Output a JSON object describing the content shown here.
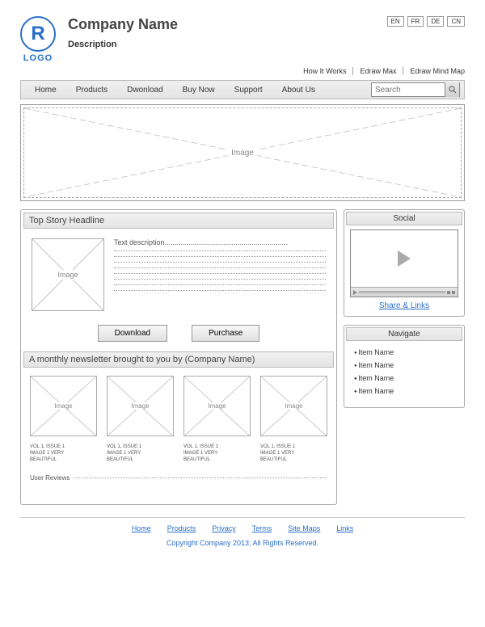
{
  "header": {
    "logo_letter": "R",
    "logo_text": "LOGO",
    "company_name": "Company Name",
    "description": "Description"
  },
  "languages": [
    "EN",
    "FR",
    "DE",
    "CN"
  ],
  "sub_links": [
    "How It Works",
    "Edraw Max",
    "Edraw Mind Map"
  ],
  "nav": [
    "Home",
    "Products",
    "Dwonload",
    "Buy Now",
    "Support",
    "About Us"
  ],
  "search_placeholder": "Search",
  "hero_label": "Image",
  "top_story": {
    "headline": "Top Story Headline",
    "image_label": "Image",
    "text_description": "Text description.............................................................",
    "download_btn": "Download",
    "purchase_btn": "Purchase"
  },
  "newsletter": {
    "headline": "A monthly newsletter brought to you by (Company Name)",
    "items": [
      {
        "img": "Image",
        "caption_l1": "VOL 1, ISSUE 1",
        "caption_l2": "IMAGE 1 VERY",
        "caption_l3": "BEAUTIFUL"
      },
      {
        "img": "Image",
        "caption_l1": "VOL 1, ISSUE 1",
        "caption_l2": "IMAGE 1 VERY",
        "caption_l3": "BEAUTIFUL"
      },
      {
        "img": "Image",
        "caption_l1": "VOL 1, ISSUE 1",
        "caption_l2": "IMAGE 1 VERY",
        "caption_l3": "BEAUTIFUL"
      },
      {
        "img": "Image",
        "caption_l1": "VOL 1, ISSUE 1",
        "caption_l2": "IMAGE 1 VERY",
        "caption_l3": "BEAUTIFUL"
      }
    ],
    "reviews_label": "User Reviews"
  },
  "social": {
    "title": "Social",
    "share_link": "Share & Links"
  },
  "navigate": {
    "title": "Navigate",
    "items": [
      "Item Name",
      "Item Name",
      "Item Name",
      "Item Name"
    ]
  },
  "footer": {
    "links": [
      "Home",
      "Products",
      "Privacy",
      "Terms",
      "Site Maps",
      "Links"
    ],
    "copyright": "Copyright Company 2013; All Rights Reserved."
  }
}
